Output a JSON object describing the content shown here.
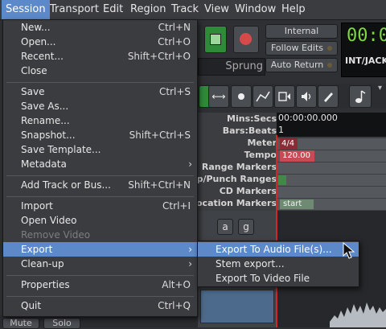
{
  "menubar": [
    "Session",
    "Transport",
    "Edit",
    "Region",
    "Track",
    "View",
    "Window",
    "Help"
  ],
  "toolbar": {
    "internal_label": "Internal",
    "follow_edits_label": "Follow Edits",
    "auto_return_label": "Auto Return",
    "sprung_label": "Sprung",
    "clock_digits": "00:0",
    "clock_source": "INT/JACK"
  },
  "rulers": {
    "labels": [
      "Mins:Secs",
      "Bars:Beats",
      "Meter",
      "Tempo",
      "Range Markers",
      "oop/Punch Ranges",
      "CD Markers",
      "Location Markers"
    ],
    "minsecs_value": "00:00:00.000",
    "bars_value": "1",
    "meter_value": "4/4",
    "tempo_value": "120.00",
    "location_marker": "start"
  },
  "mixer_strip": {
    "a_label": "a",
    "g_label": "g",
    "mute_label": "Mute",
    "solo_label": "Solo"
  },
  "session_menu": {
    "items": [
      {
        "label": "New...",
        "accel": "Ctrl+N"
      },
      {
        "label": "Open...",
        "accel": "Ctrl+O"
      },
      {
        "label": "Recent...",
        "accel": "Shift+Ctrl+O"
      },
      {
        "label": "Close",
        "accel": ""
      },
      {
        "label": "Save",
        "accel": "Ctrl+S"
      },
      {
        "label": "Save As...",
        "accel": ""
      },
      {
        "label": "Rename...",
        "accel": ""
      },
      {
        "label": "Snapshot...",
        "accel": "Shift+Ctrl+S"
      },
      {
        "label": "Save Template...",
        "accel": ""
      },
      {
        "label": "Metadata",
        "accel": ""
      },
      {
        "label": "Add Track or Bus...",
        "accel": "Shift+Ctrl+N"
      },
      {
        "label": "Import",
        "accel": "Ctrl+I"
      },
      {
        "label": "Open Video",
        "accel": ""
      },
      {
        "label": "Remove Video",
        "accel": ""
      },
      {
        "label": "Export",
        "accel": ""
      },
      {
        "label": "Clean-up",
        "accel": ""
      },
      {
        "label": "Properties",
        "accel": "Alt+O"
      },
      {
        "label": "Quit",
        "accel": "Ctrl+Q"
      }
    ]
  },
  "export_submenu": {
    "items": [
      "Export To Audio File(s)...",
      "Stem export...",
      "Export To Video File"
    ]
  },
  "colors": {
    "highlight": "#5b89c9",
    "record": "#d84a4a",
    "play": "#3cbf50",
    "tempo_marker": "#c84a55"
  }
}
